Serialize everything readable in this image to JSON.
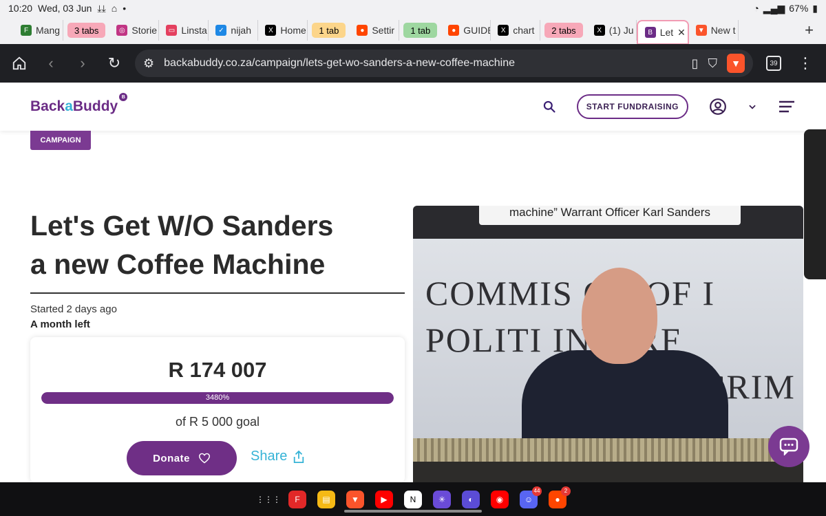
{
  "status": {
    "time": "10:20",
    "date": "Wed, 03 Jun",
    "battery": "67%"
  },
  "tabs": {
    "items": [
      {
        "label": "Mang",
        "icon_color": "#2e7d32",
        "icon_text": "F"
      },
      {
        "group": "3 tabs",
        "color": "#f7a8b8"
      },
      {
        "label": "Storie",
        "icon_color": "#c13584",
        "icon_text": "◎"
      },
      {
        "label": "Linsta",
        "icon_color": "#e4405f",
        "icon_text": "▭"
      },
      {
        "label": "nijah",
        "icon_color": "#1e88e5",
        "icon_text": "✓"
      },
      {
        "label": "Home",
        "icon_color": "#000000",
        "icon_text": "X"
      },
      {
        "group": "1 tab",
        "color": "#fcd58a"
      },
      {
        "label": "Settir",
        "icon_color": "#ff4500",
        "icon_text": "●"
      },
      {
        "group": "1 tab",
        "color": "#9ed7a0"
      },
      {
        "label": "GUIDE",
        "icon_color": "#ff4500",
        "icon_text": "●"
      },
      {
        "label": "chart",
        "icon_color": "#000000",
        "icon_text": "X"
      },
      {
        "group": "2 tabs",
        "color": "#f7a8b8"
      },
      {
        "label": "(1) Ju",
        "icon_color": "#000000",
        "icon_text": "X"
      },
      {
        "label": "Let",
        "icon_color": "#6b2c86",
        "icon_text": "B",
        "active": true
      },
      {
        "label": "New t",
        "icon_color": "#fb542b",
        "icon_text": "▼"
      }
    ]
  },
  "toolbar": {
    "url": "backabuddy.co.za/campaign/lets-get-wo-sanders-a-new-coffee-machine",
    "tab_count": "39"
  },
  "site": {
    "logo_back": "Back",
    "logo_a": "a",
    "logo_buddy": "Buddy",
    "logo_badge": "B",
    "start_fundraising": "START FUNDRAISING"
  },
  "campaign": {
    "tag": "CAMPAIGN",
    "title_line1": "Let's Get W/O Sanders",
    "title_line2": "a new Coffee Machine",
    "started": "Started 2 days ago",
    "time_left": "A month left"
  },
  "donation": {
    "raised": "R 174 007",
    "percent_label": "3480%",
    "progress_fraction": 1.0,
    "goal": "of R 5 000 goal",
    "donate_label": "Donate",
    "share_label": "Share"
  },
  "video": {
    "caption": "machine” Warrant Officer Karl Sanders",
    "wall_line1": "COMMIS  ON OF I",
    "wall_line2": "POLITI    INTERF",
    "wall_line3": "CRIM"
  },
  "taskbar": {
    "apps": [
      {
        "name": "app-drawer-icon",
        "color": "#101012",
        "glyph": "⋮⋮⋮"
      },
      {
        "name": "flipboard-icon",
        "color": "#e12828",
        "glyph": "F"
      },
      {
        "name": "notes-icon",
        "color": "#f5b915",
        "glyph": "▤"
      },
      {
        "name": "brave-icon",
        "color": "#fb542b",
        "glyph": "▼"
      },
      {
        "name": "youtube-icon",
        "color": "#ff0000",
        "glyph": "▶"
      },
      {
        "name": "notion-icon",
        "color": "#ffffff",
        "glyph": "N"
      },
      {
        "name": "grid-app-icon",
        "color": "#6a4bd8",
        "glyph": "✳"
      },
      {
        "name": "internet-icon",
        "color": "#5b4cd6",
        "glyph": "◐"
      },
      {
        "name": "youtube-music-icon",
        "color": "#ff0000",
        "glyph": "◉"
      },
      {
        "name": "discord-icon",
        "color": "#5865f2",
        "glyph": "☺",
        "badge": "44"
      },
      {
        "name": "reddit-icon",
        "color": "#ff4500",
        "glyph": "●",
        "badge": "2"
      }
    ]
  }
}
